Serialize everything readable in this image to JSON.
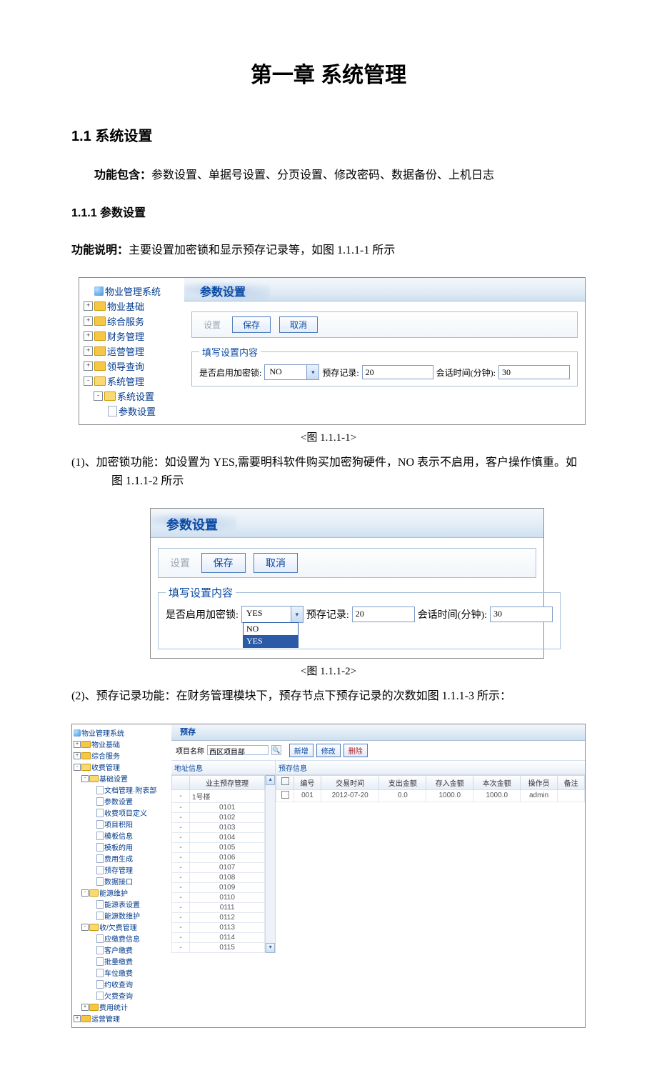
{
  "headings": {
    "chapter": "第一章 系统管理",
    "section": "1.1 系统设置",
    "subsection": "1.1.1 参数设置"
  },
  "text": {
    "functions_label": "功能包含：",
    "functions_value": "参数设置、单据号设置、分页设置、修改密码、数据备份、上机日志",
    "desc_label": "功能说明：",
    "desc_value": "主要设置加密锁和显示预存记录等，如图 1.1.1-1 所示",
    "cap1": "<图 1.1.1-1>",
    "para2": "(1)、加密锁功能：如设置为 YES,需要明科软件购买加密狗硬件，NO 表示不启用，客户操作慎重。如图 1.1.1-2 所示",
    "cap2": "<图 1.1.1-2>",
    "para3": "(2)、预存记录功能：在财务管理模块下，预存节点下预存记录的次数如图 1.1.1-3 所示："
  },
  "tree1": {
    "root": "物业管理系统",
    "items": [
      "物业基础",
      "综合服务",
      "财务管理",
      "运营管理",
      "领导查询",
      "系统管理"
    ],
    "open_item": "系统管理",
    "child1": "系统设置",
    "child2": "参数设置"
  },
  "form": {
    "panel_title": "参数设置",
    "btn_disabled": "设置",
    "btn_save": "保存",
    "btn_cancel": "取消",
    "fieldset_legend": "填写设置内容",
    "lbl_lock": "是否启用加密锁:",
    "val_lock_no": "NO",
    "val_lock_yes": "YES",
    "lbl_presave": "预存记录:",
    "val_presave": "20",
    "lbl_session": "会话时间(分钟):",
    "val_session": "30",
    "dd_opt1": "NO",
    "dd_opt2": "YES"
  },
  "app3": {
    "title": "预存",
    "tree_root": "物业管理系统",
    "tree": [
      {
        "d": 0,
        "exp": "+",
        "fold": true,
        "t": "物业基础"
      },
      {
        "d": 0,
        "exp": "+",
        "fold": true,
        "t": "综合服务"
      },
      {
        "d": 0,
        "exp": "-",
        "fold": true,
        "open": true,
        "t": "收费管理"
      },
      {
        "d": 1,
        "exp": "-",
        "fold": true,
        "open": true,
        "t": "基础设置"
      },
      {
        "d": 2,
        "doc": true,
        "t": "文档管理·附表部"
      },
      {
        "d": 2,
        "doc": true,
        "t": "参数设置"
      },
      {
        "d": 2,
        "doc": true,
        "t": "收费项目定义"
      },
      {
        "d": 2,
        "doc": true,
        "t": "项目积阳"
      },
      {
        "d": 2,
        "doc": true,
        "t": "模板信息"
      },
      {
        "d": 2,
        "doc": true,
        "t": "模板的用"
      },
      {
        "d": 2,
        "doc": true,
        "t": "费用生成"
      },
      {
        "d": 2,
        "doc": true,
        "t": "预存管理"
      },
      {
        "d": 2,
        "doc": true,
        "t": "数据接口"
      },
      {
        "d": 1,
        "exp": "-",
        "fold": true,
        "open": true,
        "t": "能源维护"
      },
      {
        "d": 2,
        "doc": true,
        "t": "能源表设置"
      },
      {
        "d": 2,
        "doc": true,
        "t": "能源数维护"
      },
      {
        "d": 1,
        "exp": "-",
        "fold": true,
        "open": true,
        "t": "收/欠费管理"
      },
      {
        "d": 2,
        "doc": true,
        "t": "应缴费信息"
      },
      {
        "d": 2,
        "doc": true,
        "t": "客户缴费"
      },
      {
        "d": 2,
        "doc": true,
        "t": "批量缴费"
      },
      {
        "d": 2,
        "doc": true,
        "t": "车位缴费"
      },
      {
        "d": 2,
        "doc": true,
        "t": "约收查询"
      },
      {
        "d": 2,
        "doc": true,
        "t": "欠费查询"
      },
      {
        "d": 1,
        "exp": "+",
        "fold": true,
        "t": "费用统计"
      },
      {
        "d": 0,
        "exp": "+",
        "fold": true,
        "t": "运营管理"
      }
    ],
    "query_label": "项目名称",
    "query_value": "西区项目部",
    "btns": {
      "new": "新增",
      "edit": "修改",
      "del": "删除"
    },
    "left_header": "地址信息",
    "right_header": "预存信息",
    "left_cols": [
      "",
      "业主预存管理"
    ],
    "left_root": "1号楼",
    "left_rooms": [
      "0101",
      "0102",
      "0103",
      "0104",
      "0105",
      "0106",
      "0107",
      "0108",
      "0109",
      "0110",
      "0111",
      "0112",
      "0113",
      "0114",
      "0115"
    ],
    "right_cols": [
      "",
      "编号",
      "交易时间",
      "支出金额",
      "存入金额",
      "本次金额",
      "操作员",
      "备注"
    ],
    "right_row": {
      "no": "001",
      "date": "2012-07-20",
      "out": "0.0",
      "in": "1000.0",
      "cur": "1000.0",
      "op": "admin",
      "remark": ""
    }
  }
}
